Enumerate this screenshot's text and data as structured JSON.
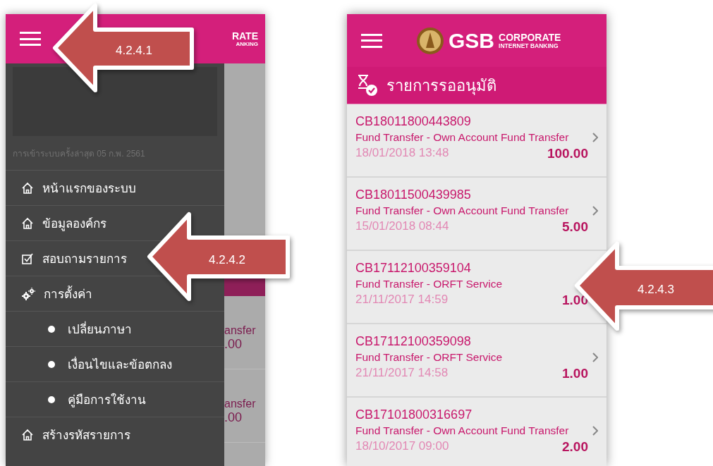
{
  "menu_screen": {
    "logo_fragment_top": "RATE",
    "logo_fragment_bottom": "ANKING",
    "last_login": "การเข้าระบบครั้งล่าสุด 05 ก.พ. 2561",
    "menu": [
      {
        "label": "หน้าแรกของระบบ",
        "kind": "home"
      },
      {
        "label": "ข้อมูลองค์กร",
        "kind": "home"
      },
      {
        "label": "สอบถามรายการ",
        "kind": "check"
      },
      {
        "label": "การตั้งค่า",
        "kind": "gears",
        "children": [
          {
            "label": "เปลี่ยนภาษา"
          },
          {
            "label": "เงื่อนไขและข้อตกลง"
          },
          {
            "label": "คู่มือการใช้งาน"
          }
        ]
      },
      {
        "label": "สร้างรหัสรายการ",
        "kind": "home"
      }
    ],
    "background_rows": [
      {
        "description": "ansfer",
        "amount": ".00"
      },
      {
        "description": "ansfer",
        "amount": ".00"
      }
    ]
  },
  "app_screen": {
    "brand": "GSB",
    "brand_line_1": "CORPORATE",
    "brand_line_2": "INTERNET BANKING",
    "title": "รายการรออนุมัติ",
    "transactions": [
      {
        "id": "CB18011800443809",
        "description": "Fund Transfer - Own Account Fund Transfer",
        "date": "18/01/2018 13:48",
        "amount": "100.00"
      },
      {
        "id": "CB18011500439985",
        "description": "Fund Transfer - Own Account Fund Transfer",
        "date": "15/01/2018 08:44",
        "amount": "5.00"
      },
      {
        "id": "CB17112100359104",
        "description": "Fund Transfer - ORFT Service",
        "date": "21/11/2017 14:59",
        "amount": "1.00"
      },
      {
        "id": "CB17112100359098",
        "description": "Fund Transfer - ORFT Service",
        "date": "21/11/2017 14:58",
        "amount": "1.00"
      },
      {
        "id": "CB17101800316697",
        "description": "Fund Transfer - Own Account Fund Transfer",
        "date": "18/10/2017 09:00",
        "amount": "2.00"
      }
    ]
  },
  "callouts": [
    {
      "label": "4.2.4.1"
    },
    {
      "label": "4.2.4.2"
    },
    {
      "label": "4.2.4.3"
    }
  ]
}
